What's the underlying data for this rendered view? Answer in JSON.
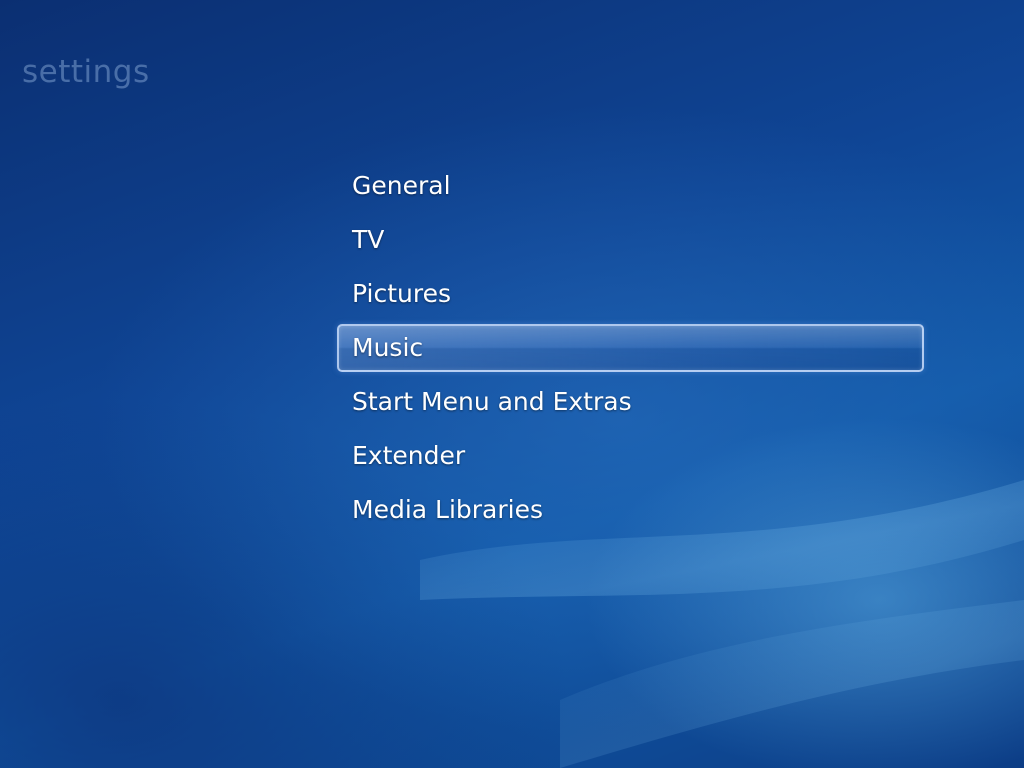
{
  "page": {
    "title": "settings"
  },
  "menu": {
    "items": [
      {
        "label": "General",
        "selected": false
      },
      {
        "label": "TV",
        "selected": false
      },
      {
        "label": "Pictures",
        "selected": false
      },
      {
        "label": "Music",
        "selected": true
      },
      {
        "label": "Start Menu and Extras",
        "selected": false
      },
      {
        "label": "Extender",
        "selected": false
      },
      {
        "label": "Media Libraries",
        "selected": false
      }
    ]
  },
  "colors": {
    "background_dark": "#0b2f72",
    "background_mid": "#125aa9",
    "title_text": "#6f8fbf",
    "item_text": "#ffffff",
    "focus_border": "#c8dcfa"
  }
}
